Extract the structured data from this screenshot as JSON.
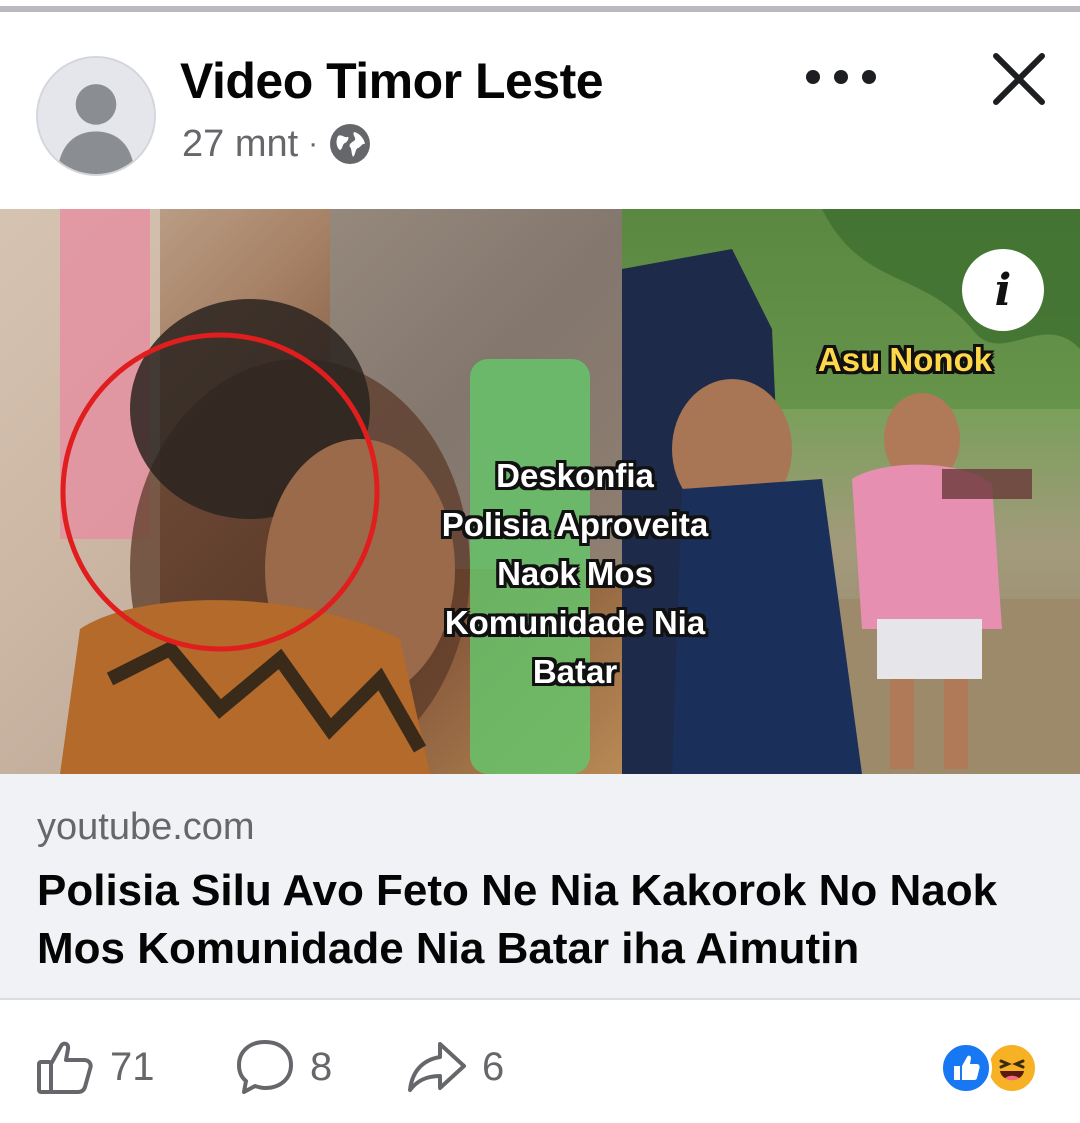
{
  "post": {
    "author": "Video Timor Leste",
    "time": "27 mnt",
    "separator": "·",
    "audience_icon": "globe-icon"
  },
  "header_actions": {
    "more_icon": "more-horizontal-icon",
    "close_icon": "close-icon"
  },
  "media": {
    "overlay_lines": [
      "Deskonfia",
      "Polisia Aproveita",
      "Naok Mos",
      "Komunidade Nia",
      "Batar"
    ],
    "tag": "Asu Nonok",
    "info_label": "i"
  },
  "link_preview": {
    "domain": "youtube.com",
    "title": "Polisia Silu Avo Feto Ne Nia Kakorok No Naok Mos Komunidade Nia Batar iha Aimutin"
  },
  "footer": {
    "like_count": "71",
    "comment_count": "8",
    "share_count": "6",
    "reaction_icons": [
      "like-reaction-icon",
      "haha-reaction-icon"
    ],
    "colors": {
      "like_blue": "#1877f2",
      "haha_yellow": "#f7b125",
      "secondary_text": "#65676b"
    }
  }
}
